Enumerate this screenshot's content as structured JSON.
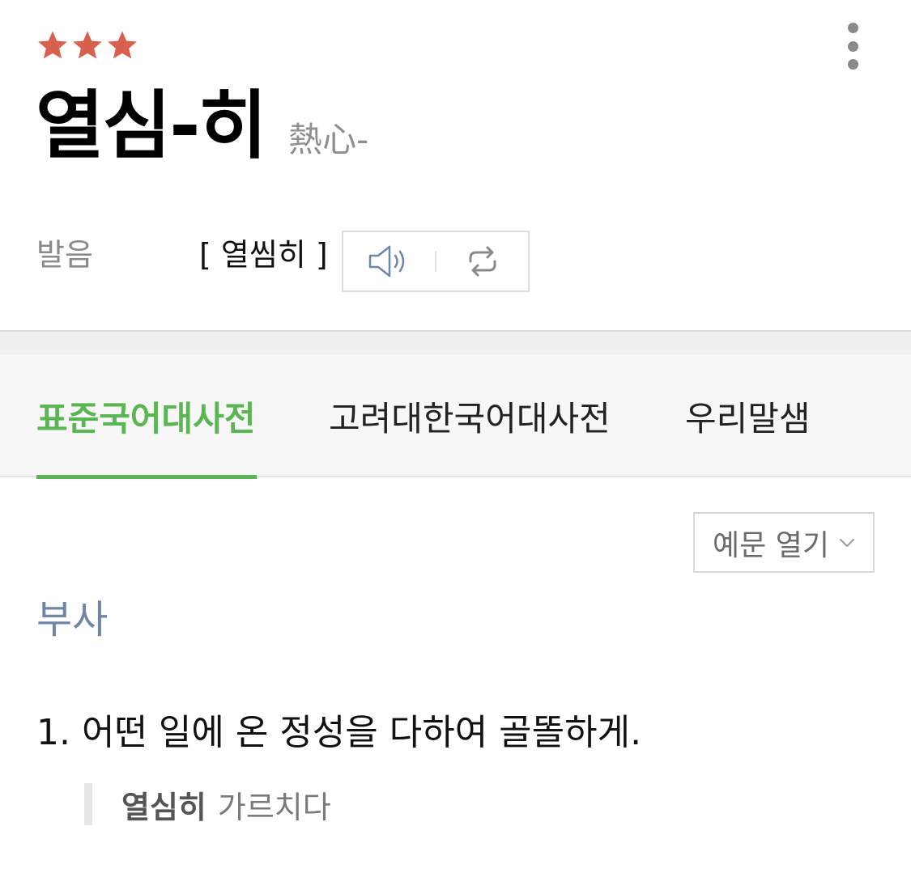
{
  "rating": {
    "stars": 3,
    "star_color": "#d9604c"
  },
  "entry": {
    "headword": "열심-히",
    "hanja": "熱心-"
  },
  "pronunciation": {
    "label": "발음",
    "text": "[ 열씸히 ]",
    "play_icon": "speaker-icon",
    "repeat_icon": "repeat-icon"
  },
  "tabs": [
    {
      "label": "표준국어대사전",
      "active": true
    },
    {
      "label": "고려대한국어대사전",
      "active": false
    },
    {
      "label": "우리말샘",
      "active": false
    }
  ],
  "example_toggle": {
    "label": "예문 열기"
  },
  "part_of_speech": "부사",
  "definitions": [
    {
      "text": "1. 어떤 일에 온 정성을 다하여 골똘하게.",
      "example": {
        "word": "열심히",
        "rest": "가르치다"
      }
    }
  ],
  "colors": {
    "accent_green": "#5ab552",
    "pos_blue": "#6f86a8",
    "icon_gray": "#8a8a8a"
  }
}
